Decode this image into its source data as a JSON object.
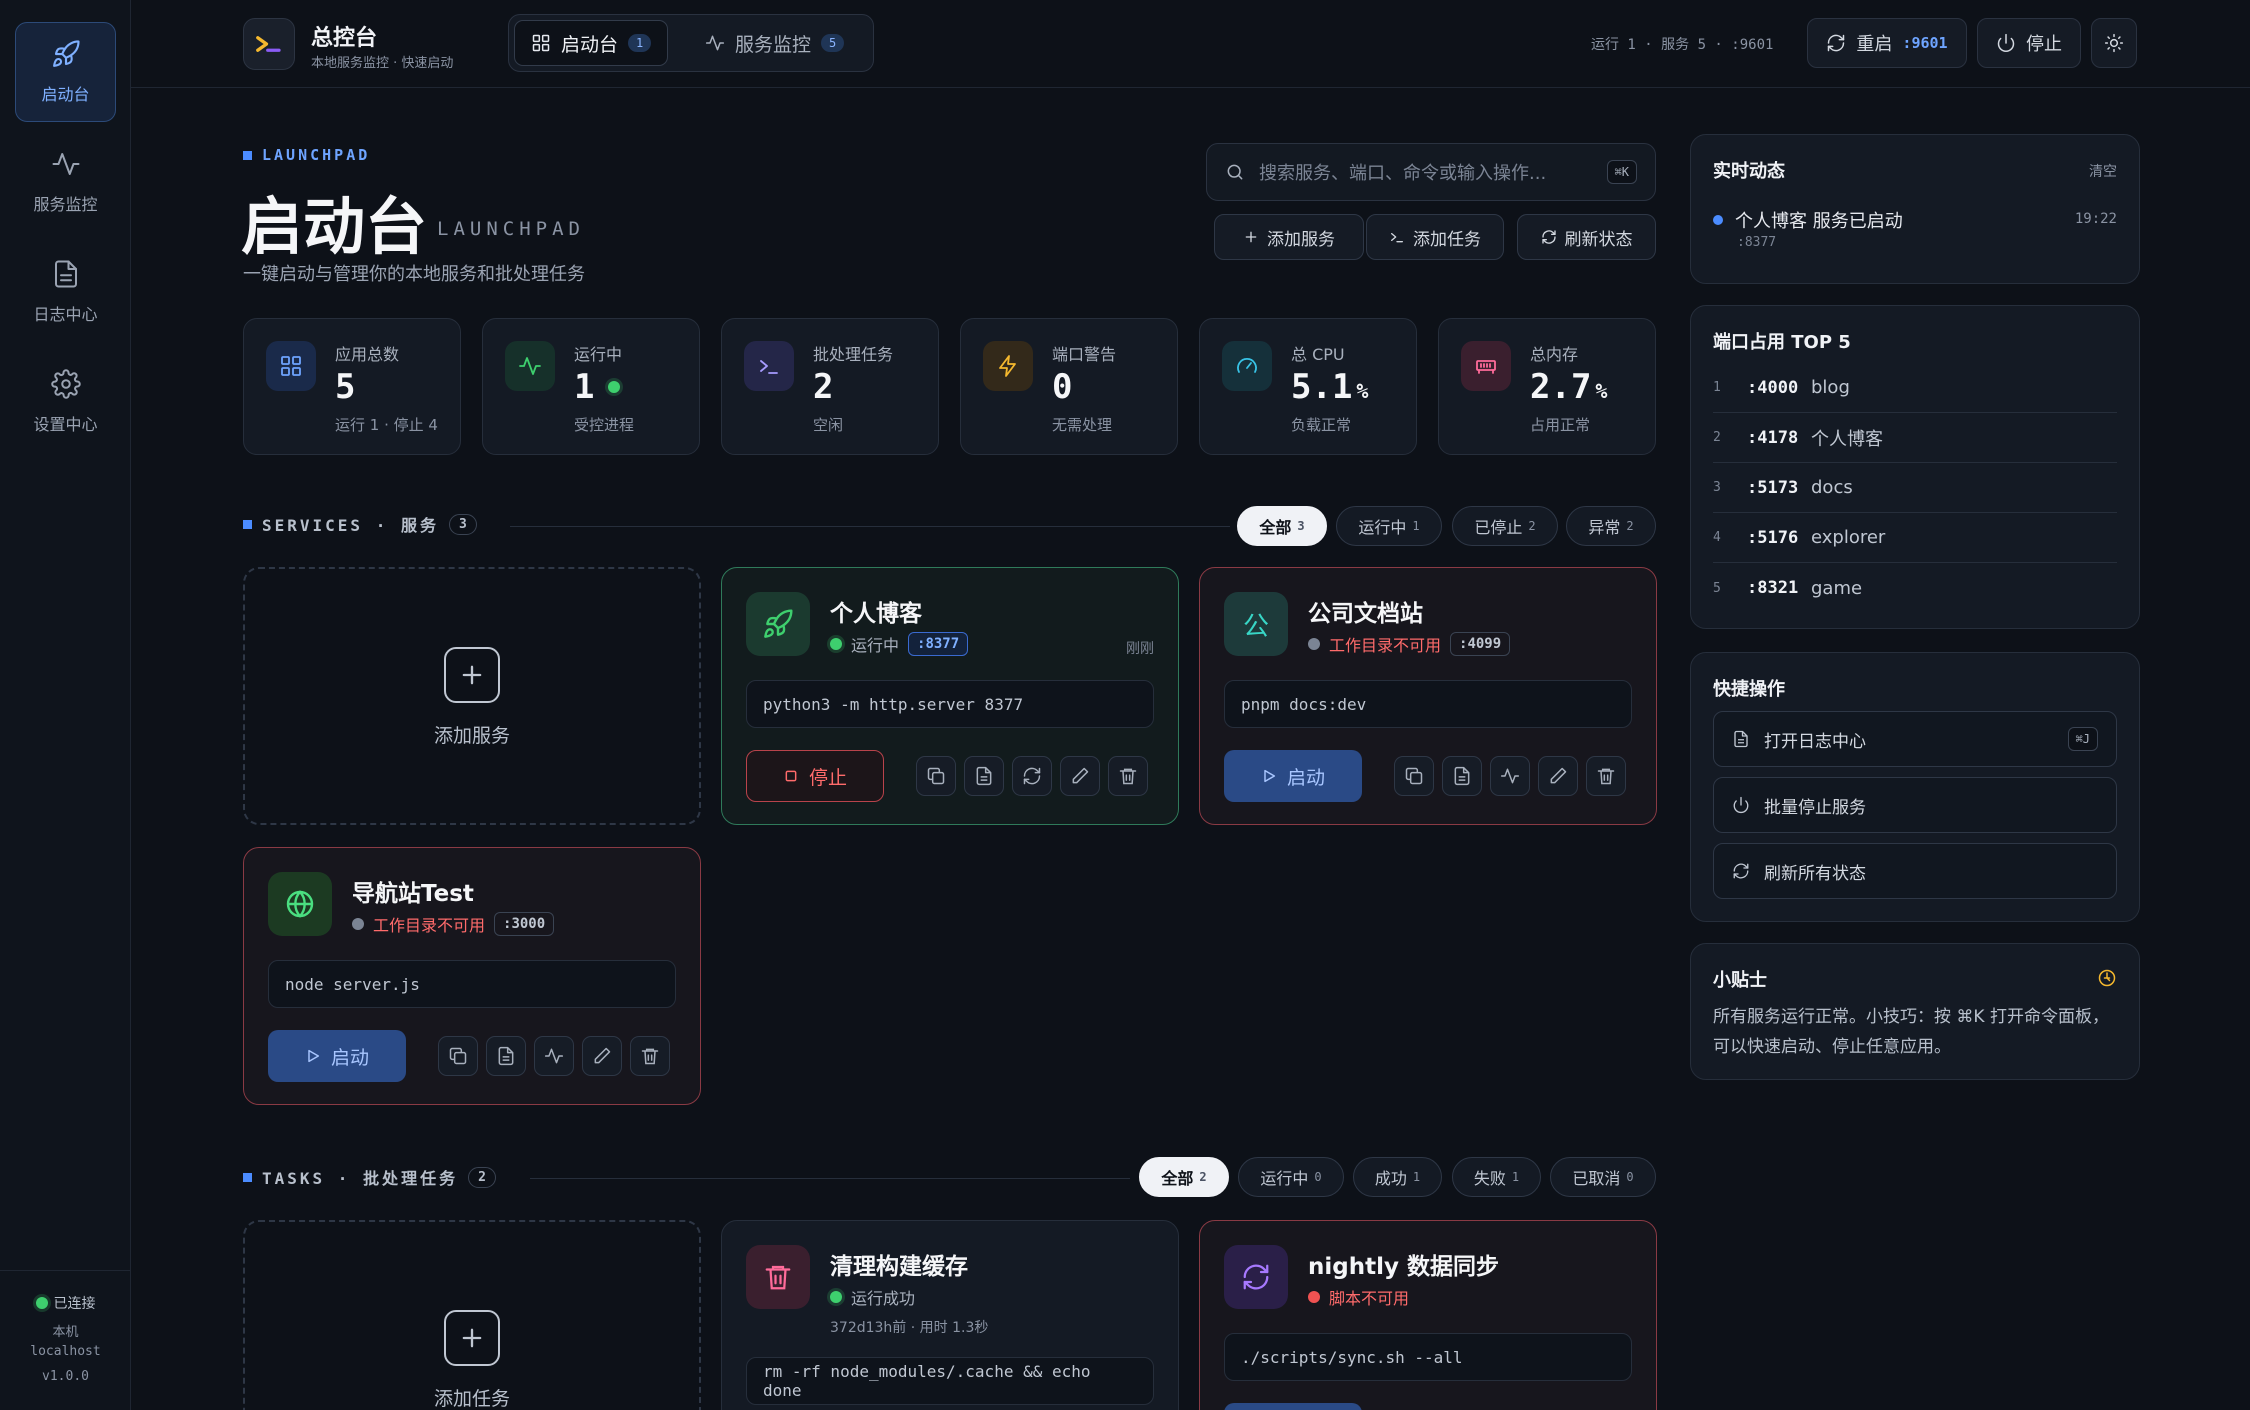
{
  "sidebar": {
    "items": [
      {
        "label": "启动台",
        "icon": "rocket-icon"
      },
      {
        "label": "服务监控",
        "icon": "activity-icon"
      },
      {
        "label": "日志中心",
        "icon": "file-icon"
      },
      {
        "label": "设置中心",
        "icon": "gear-icon"
      }
    ],
    "footer": {
      "status": "已连接",
      "host_label": "本机",
      "host": "localhost",
      "version": "v1.0.0"
    }
  },
  "topbar": {
    "title": "总控台",
    "subtitle": "本地服务监控 · 快速启动",
    "tabs": [
      {
        "label": "启动台",
        "count": "1"
      },
      {
        "label": "服务监控",
        "count": "5"
      }
    ],
    "status_line": "运行 1 · 服务 5 · :9601",
    "restart_label": "重启",
    "restart_port": ":9601",
    "stop_label": "停止"
  },
  "header": {
    "kicker": "LAUNCHPAD",
    "title": "启动台",
    "title_en": "LAUNCHPAD",
    "description": "一键启动与管理你的本地服务和批处理任务",
    "search_placeholder": "搜索服务、端口、命令或输入操作...",
    "search_shortcut": "⌘K",
    "actions": [
      "添加服务",
      "添加任务",
      "刷新状态"
    ]
  },
  "stats": [
    {
      "label": "应用总数",
      "value": "5",
      "unit": "",
      "sub": "运行 1 · 停止 4",
      "icon": "grid-icon"
    },
    {
      "label": "运行中",
      "value": "1",
      "unit": "",
      "sub": "受控进程",
      "icon": "pulse-icon"
    },
    {
      "label": "批处理任务",
      "value": "2",
      "unit": "",
      "sub": "空闲",
      "icon": "terminal-icon"
    },
    {
      "label": "端口警告",
      "value": "0",
      "unit": "",
      "sub": "无需处理",
      "icon": "bolt-icon"
    },
    {
      "label": "总 CPU",
      "value": "5.1",
      "unit": "%",
      "sub": "负载正常",
      "icon": "gauge-icon"
    },
    {
      "label": "总内存",
      "value": "2.7",
      "unit": "%",
      "sub": "占用正常",
      "icon": "memory-icon"
    }
  ],
  "services": {
    "heading": "SERVICES · 服务",
    "count": "3",
    "filters": [
      {
        "label": "全部",
        "n": "3"
      },
      {
        "label": "运行中",
        "n": "1"
      },
      {
        "label": "已停止",
        "n": "2"
      },
      {
        "label": "异常",
        "n": "2"
      }
    ],
    "add_label": "添加服务",
    "cards": [
      {
        "name": "个人博客",
        "status": "运行中",
        "port": ":8377",
        "time": "刚刚",
        "cmd": "python3 -m http.server 8377",
        "action": "停止"
      },
      {
        "name": "公司文档站",
        "status": "工作目录不可用",
        "port": ":4099",
        "cmd": "pnpm docs:dev",
        "action": "启动",
        "icon_char": "公"
      },
      {
        "name": "导航站Test",
        "status": "工作目录不可用",
        "port": ":3000",
        "cmd": "node server.js",
        "action": "启动"
      }
    ]
  },
  "tasks": {
    "heading": "TASKS · 批处理任务",
    "count": "2",
    "filters": [
      {
        "label": "全部",
        "n": "2"
      },
      {
        "label": "运行中",
        "n": "0"
      },
      {
        "label": "成功",
        "n": "1"
      },
      {
        "label": "失败",
        "n": "1"
      },
      {
        "label": "已取消",
        "n": "0"
      }
    ],
    "add_label": "添加任务",
    "cards": [
      {
        "name": "清理构建缓存",
        "status": "运行成功",
        "meta": "372d13h前 · 用时 1.3秒",
        "cmd": "rm -rf node_modules/.cache && echo done"
      },
      {
        "name": "nightly 数据同步",
        "status": "脚本不可用",
        "cmd": "./scripts/sync.sh --all"
      }
    ]
  },
  "live": {
    "title": "实时动态",
    "clear_label": "清空",
    "events": [
      {
        "text": "个人博客 服务已启动",
        "sub": ":8377",
        "time": "19:22"
      }
    ]
  },
  "ports": {
    "title": "端口占用 TOP 5",
    "rows": [
      {
        "i": "1",
        "port": ":4000",
        "name": "blog"
      },
      {
        "i": "2",
        "port": ":4178",
        "name": "个人博客"
      },
      {
        "i": "3",
        "port": ":5173",
        "name": "docs"
      },
      {
        "i": "4",
        "port": ":5176",
        "name": "explorer"
      },
      {
        "i": "5",
        "port": ":8321",
        "name": "game"
      }
    ]
  },
  "quick": {
    "title": "快捷操作",
    "items": [
      {
        "label": "打开日志中心",
        "shortcut": "⌘J"
      },
      {
        "label": "批量停止服务"
      },
      {
        "label": "刷新所有状态"
      }
    ]
  },
  "tip": {
    "title": "小贴士",
    "text": "所有服务运行正常。小技巧：按 ⌘K 打开命令面板，可以快速启动、停止任意应用。"
  },
  "colors": {
    "accent": "#4b8cff",
    "running": "#3ecf6e",
    "error": "#ff6b6b",
    "background": "#0d1118"
  }
}
